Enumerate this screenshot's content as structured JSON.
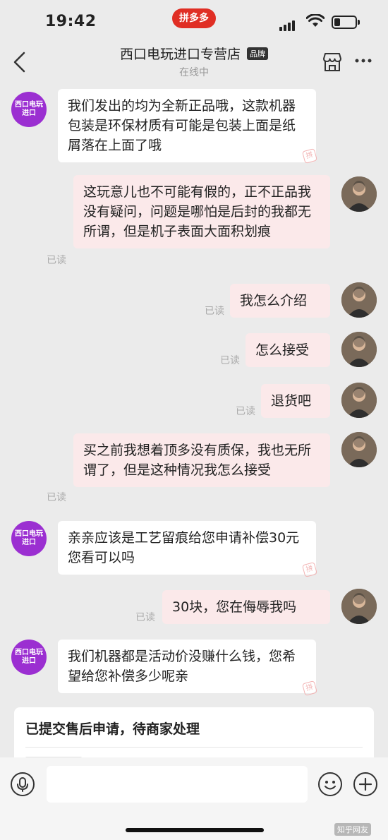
{
  "status_bar": {
    "time": "19:42",
    "app_label": "拼多多"
  },
  "header": {
    "title": "西口电玩进口专营店",
    "badge": "品牌",
    "subtitle": "在线中"
  },
  "shop_avatar_text": "西口电玩\n进口",
  "read_label": "已读",
  "messages": [
    {
      "side": "left",
      "text": "我们发出的均为全新正品哦，这款机器包装是环保材质有可能是包装上面是纸屑落在上面了哦"
    },
    {
      "side": "right",
      "text": "这玩意儿也不可能有假的，正不正品我没有疑问，问题是哪怕是后封的我都无所谓，但是机子表面大面积划痕"
    },
    {
      "side": "right",
      "text": "我怎么介绍"
    },
    {
      "side": "right",
      "text": "怎么接受"
    },
    {
      "side": "right",
      "text": "退货吧"
    },
    {
      "side": "right",
      "text": "买之前我想着顶多没有质保，我也无所谓了，但是这种情况我怎么接受"
    },
    {
      "side": "left",
      "text": "亲亲应该是工艺留痕给您申请补偿30元您看可以吗"
    },
    {
      "side": "right",
      "text": "30块，您在侮辱我吗"
    },
    {
      "side": "left",
      "text": "我们机器都是活动价没赚什么钱，您希望给您补偿多少呢亲"
    }
  ],
  "after_sale_card": {
    "text": "已提交售后申请，待商家处理"
  },
  "watermark": "知乎网友",
  "colors": {
    "brand": "#e02e24",
    "shop_avatar": "#9b2fd1",
    "my_bubble": "#fbe9ea",
    "shop_bubble": "#ffffff"
  }
}
